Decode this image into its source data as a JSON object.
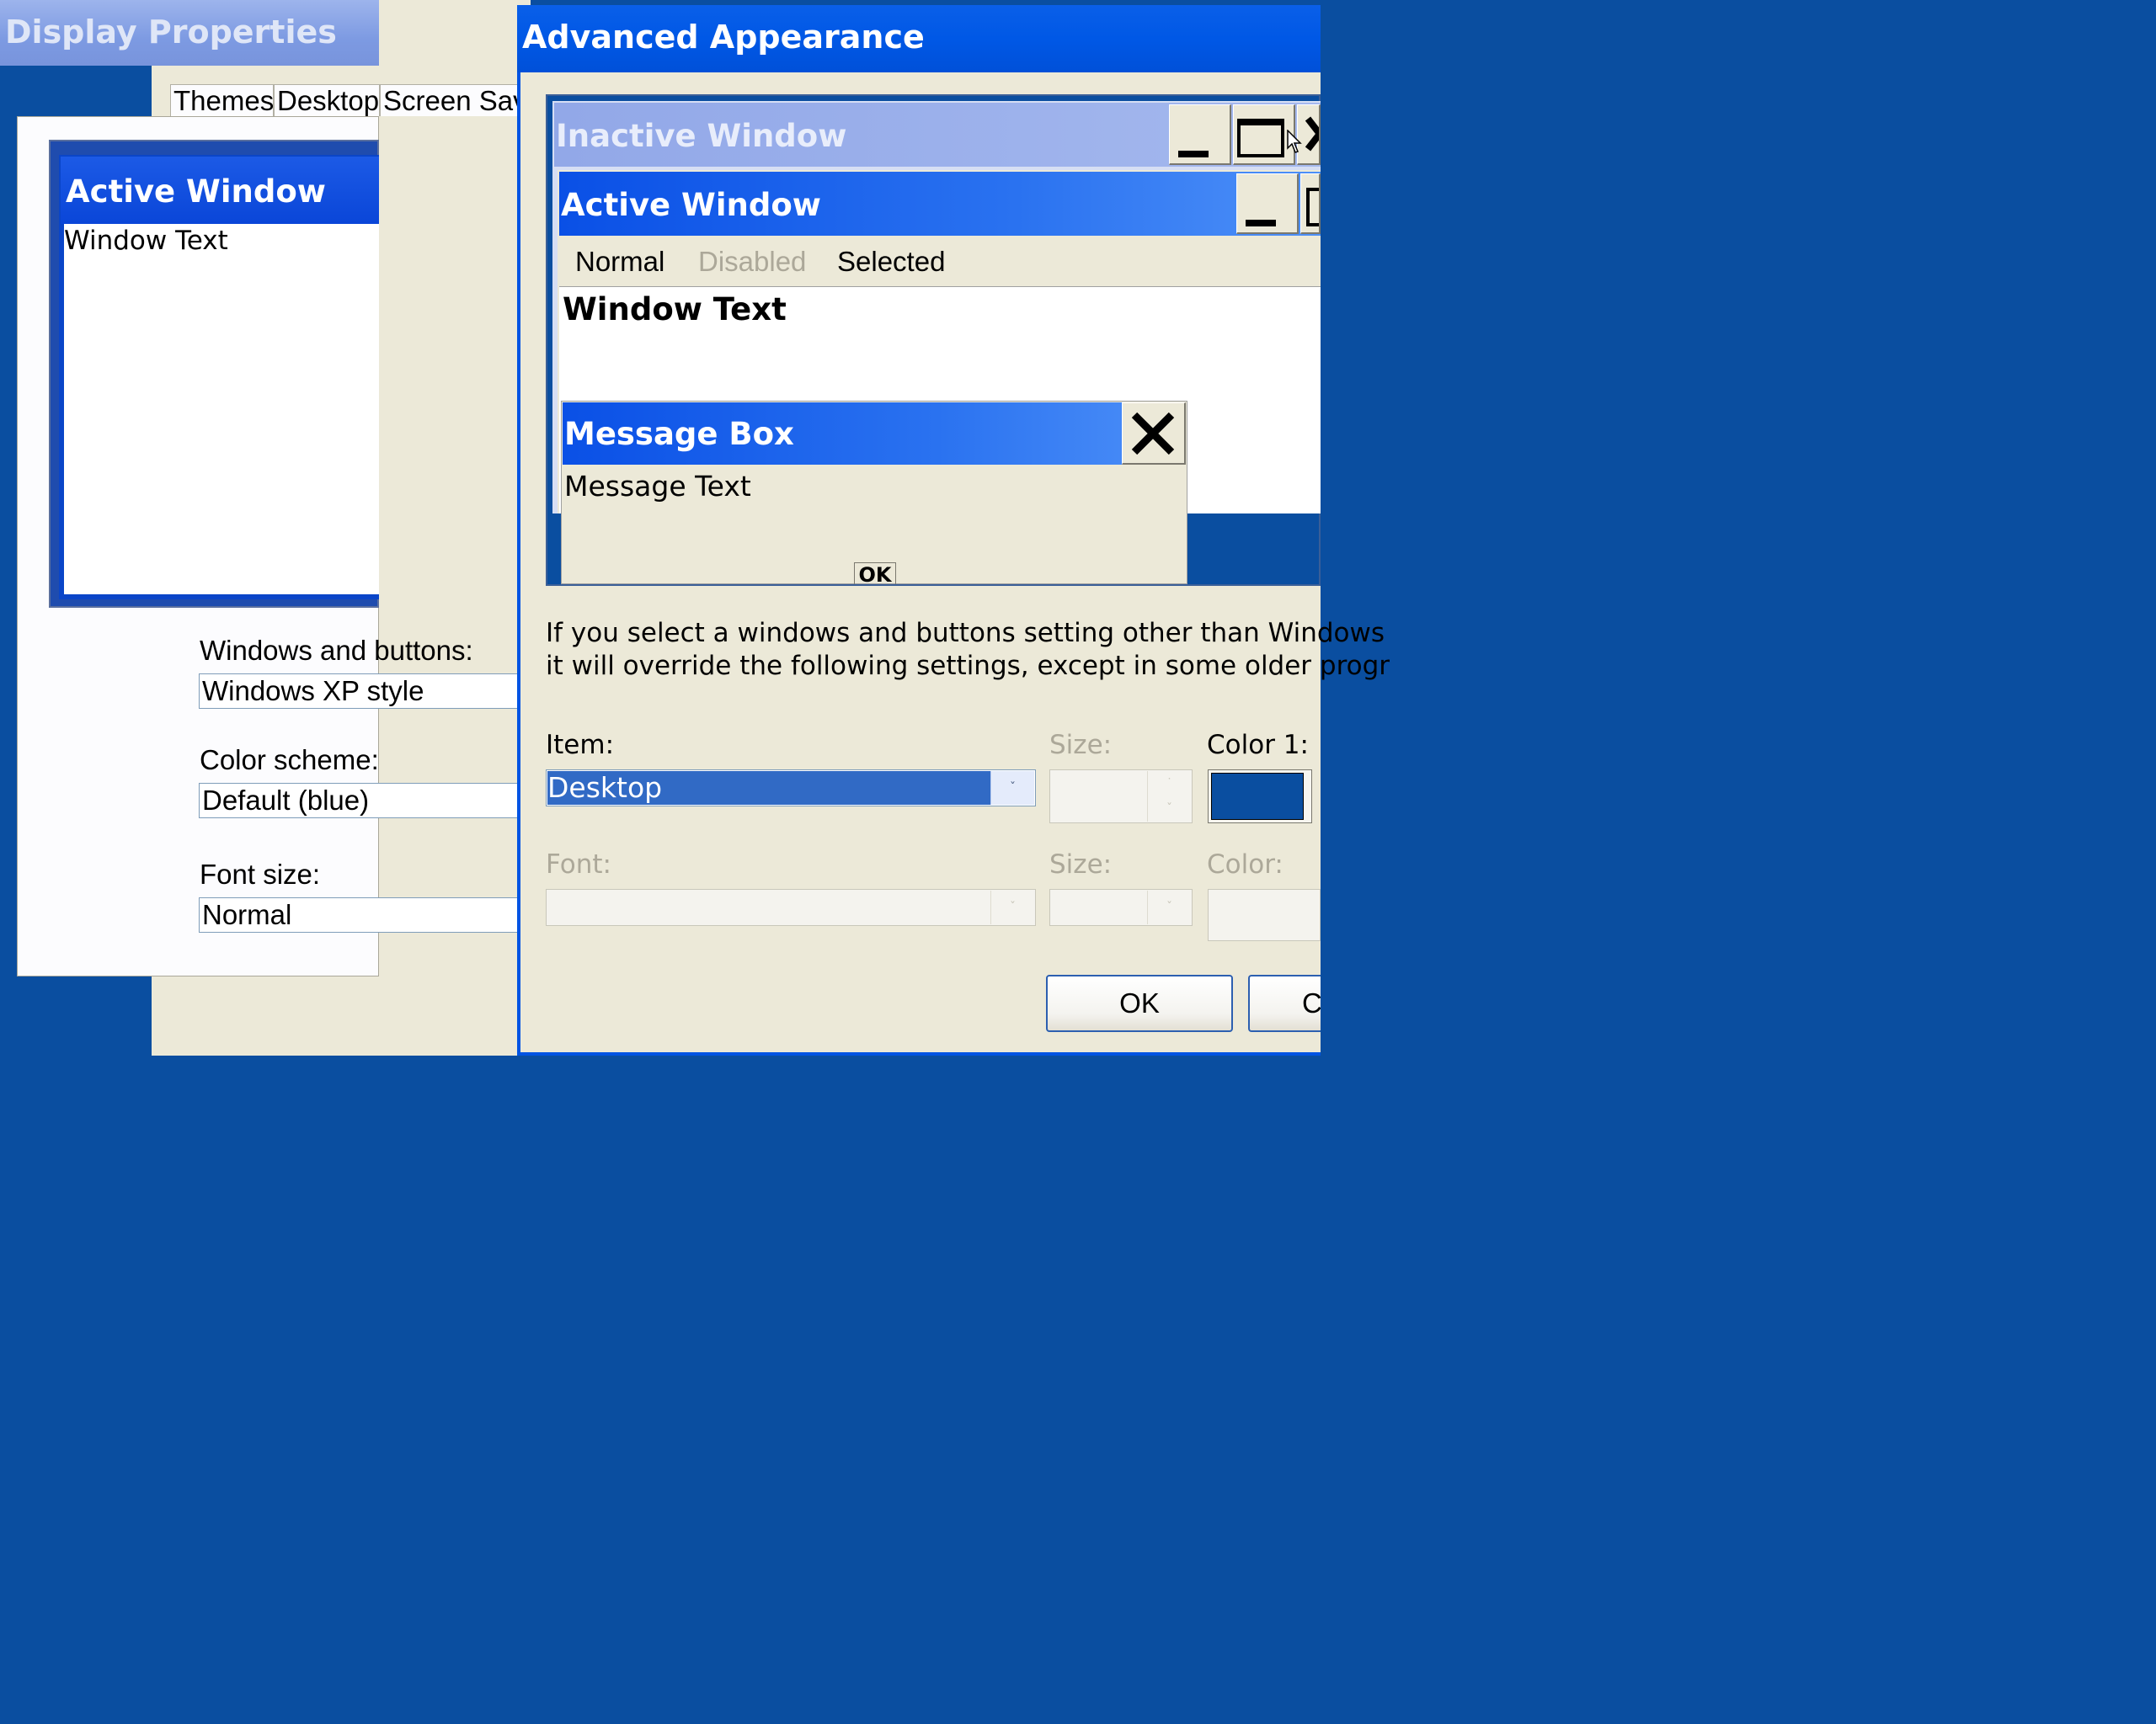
{
  "display_properties": {
    "title": "Display Properties",
    "tabs": [
      "Themes",
      "Desktop",
      "Screen Sav"
    ],
    "preview": {
      "active_window_title": "Active Window",
      "window_text": "Window Text"
    },
    "windows_and_buttons_label": "Windows and buttons:",
    "windows_and_buttons_value": "Windows XP style",
    "color_scheme_label": "Color scheme:",
    "color_scheme_value": "Default (blue)",
    "font_size_label": "Font size:",
    "font_size_value": "Normal"
  },
  "advanced_appearance": {
    "title": "Advanced Appearance",
    "preview": {
      "inactive_window_title": "Inactive Window",
      "active_window_title": "Active Window",
      "menu_normal": "Normal",
      "menu_disabled": "Disabled",
      "menu_selected": "Selected",
      "window_text": "Window Text",
      "message_box_title": "Message Box",
      "message_text": "Message Text",
      "ok_label": "OK"
    },
    "info_line1": "If you select a windows and buttons setting other than Windows",
    "info_line2": "it will override the following settings, except in some older progr",
    "item_label": "Item:",
    "item_value": "Desktop",
    "size_label": "Size:",
    "color1_label": "Color 1:",
    "color1_value": "#0a4ea0",
    "font_label": "Font:",
    "font_size_label": "Size:",
    "font_color_label": "Color:",
    "ok_button": "OK",
    "cancel_button": "C"
  }
}
